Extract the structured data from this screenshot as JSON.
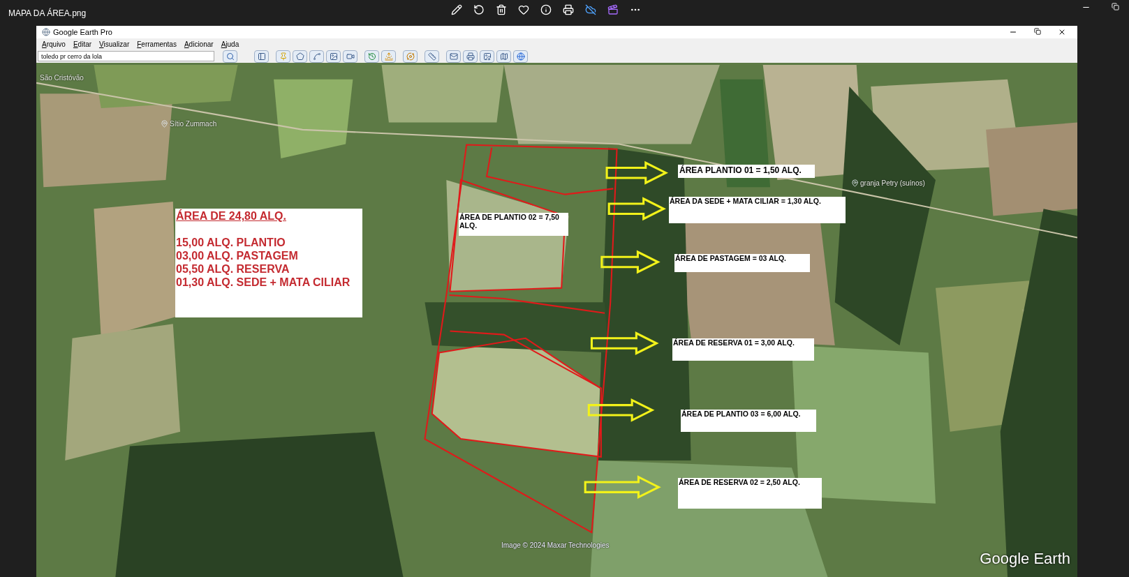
{
  "viewer": {
    "title": "MAPA DA ÁREA.png"
  },
  "app_window": {
    "title": "Google Earth Pro",
    "menu": [
      "Arquivo",
      "Editar",
      "Visualizar",
      "Ferramentas",
      "Adicionar",
      "Ajuda"
    ],
    "search": {
      "value": "toledo pr cerro da lola"
    }
  },
  "map": {
    "place_labels": [
      {
        "text": "São Cristóvão",
        "pin": false
      },
      {
        "text": "Sítio Zummach",
        "pin": true
      },
      {
        "text": "granja Petry (suínos)",
        "pin": true
      }
    ],
    "summary": {
      "title": "ÁREA DE 24,80 ALQ.",
      "lines": [
        "15,00 ALQ. PLANTIO",
        "03,00 ALQ. PASTAGEM",
        "05,50 ALQ. RESERVA",
        "01,30 ALQ. SEDE + MATA CILIAR"
      ]
    },
    "area_labels": [
      {
        "text": "ÁREA PLANTIO 01 = 1,50 ALQ."
      },
      {
        "text": "ÁREA DA SEDE + MATA CILIAR = 1,30 ALQ."
      },
      {
        "text": "ÁREA DE PLANTIO 02 = 7,50 ALQ."
      },
      {
        "text": "ÁREA DE PASTAGEM = 03 ALQ."
      },
      {
        "text": "ÁREA DE RESERVA 01 = 3,00 ALQ."
      },
      {
        "text": "ÁREA DE PLANTIO 03 = 6,00 ALQ."
      },
      {
        "text": "ÁREA DE RESERVA 02 = 2,50 ALQ."
      }
    ],
    "attribution": "Image © 2024 Maxar Technologies",
    "logo": "Google Earth"
  }
}
